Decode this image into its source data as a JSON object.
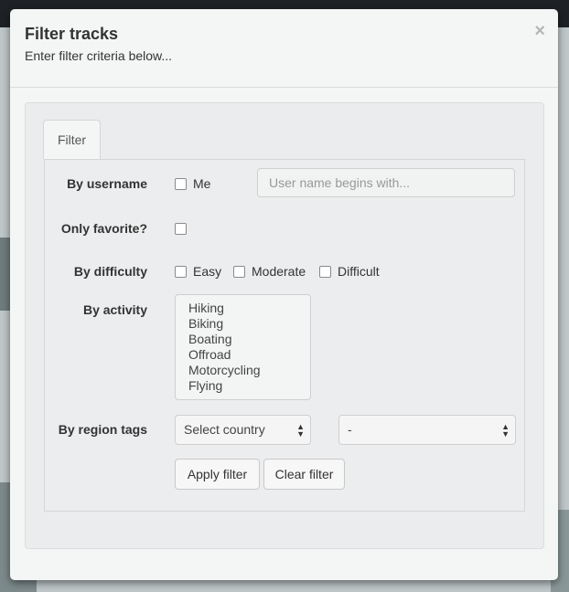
{
  "modal": {
    "title": "Filter tracks",
    "subtitle": "Enter filter criteria below...",
    "close_label": "×"
  },
  "tabs": [
    {
      "label": "Filter",
      "active": true
    }
  ],
  "form": {
    "username": {
      "label": "By username",
      "me_label": "Me",
      "me_checked": false,
      "placeholder": "User name begins with..."
    },
    "favorite": {
      "label": "Only favorite?",
      "checked": false
    },
    "difficulty": {
      "label": "By difficulty",
      "options": [
        {
          "label": "Easy",
          "checked": false
        },
        {
          "label": "Moderate",
          "checked": false
        },
        {
          "label": "Difficult",
          "checked": false
        }
      ]
    },
    "activity": {
      "label": "By activity",
      "options": [
        "Hiking",
        "Biking",
        "Boating",
        "Offroad",
        "Motorcycling",
        "Flying"
      ]
    },
    "region": {
      "label": "By region tags",
      "country_selected": "Select country",
      "region_selected": "-"
    },
    "buttons": {
      "apply": "Apply filter",
      "clear": "Clear filter"
    }
  },
  "colors": {
    "modal_bg": "#f4f5f5",
    "well_bg": "#ebeced",
    "text": "#333333",
    "placeholder": "#999999"
  }
}
